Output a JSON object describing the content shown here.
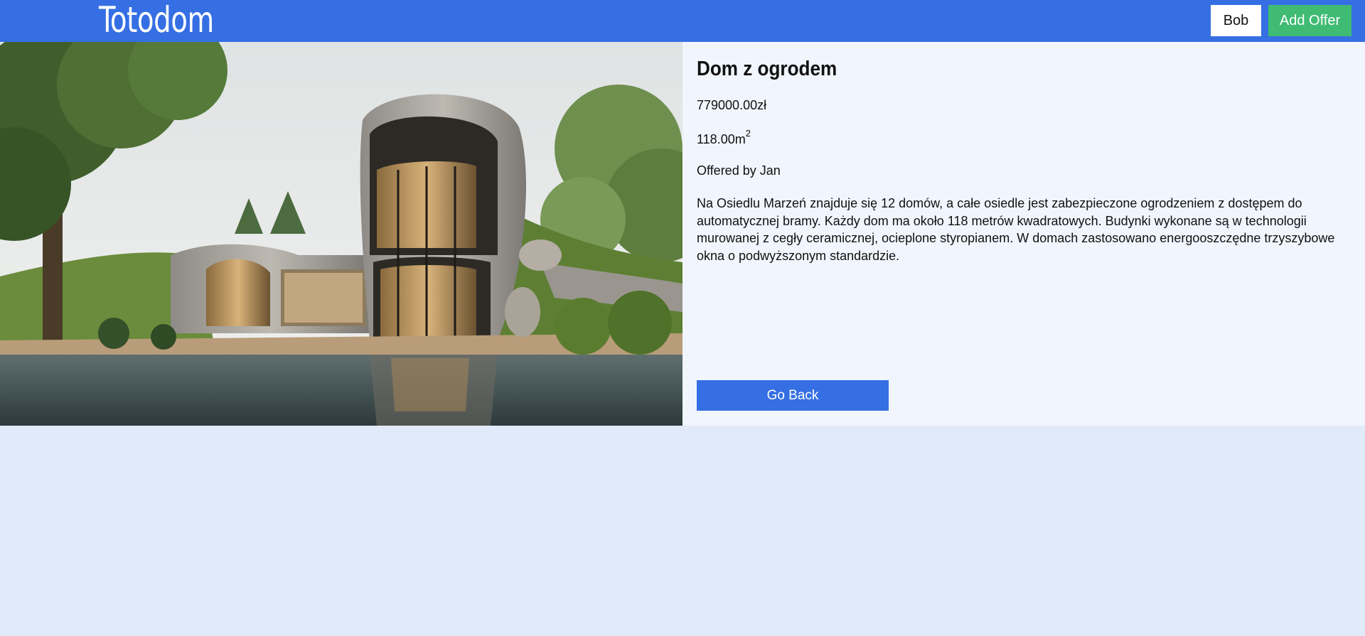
{
  "navbar": {
    "brand": "Totodom",
    "user_label": "Bob",
    "add_offer_label": "Add Offer"
  },
  "offer": {
    "title": "Dom z ogrodem",
    "price": "779000.00zł",
    "area_value": "118.00m",
    "area_exponent": "2",
    "offered_by": "Offered by Jan",
    "description": "Na Osiedlu Marzeń znajduje się 12 domów, a całe osiedle jest zabezpieczone ogrodzeniem z dostępem do automatycznej bramy. Każdy dom ma około 118 metrów kwadratowych. Budynki wykonane są w technologii murowanej z cegły ceramicznej, ocieplone styropianem. W domach zastosowano energooszczędne trzyszybowe okna o podwyższonym standardzie.",
    "back_label": "Go Back"
  },
  "colors": {
    "primary": "#356fe3",
    "success": "#3fbb74",
    "page_background": "#e0eaf9",
    "panel_background": "#f1f5fd"
  }
}
